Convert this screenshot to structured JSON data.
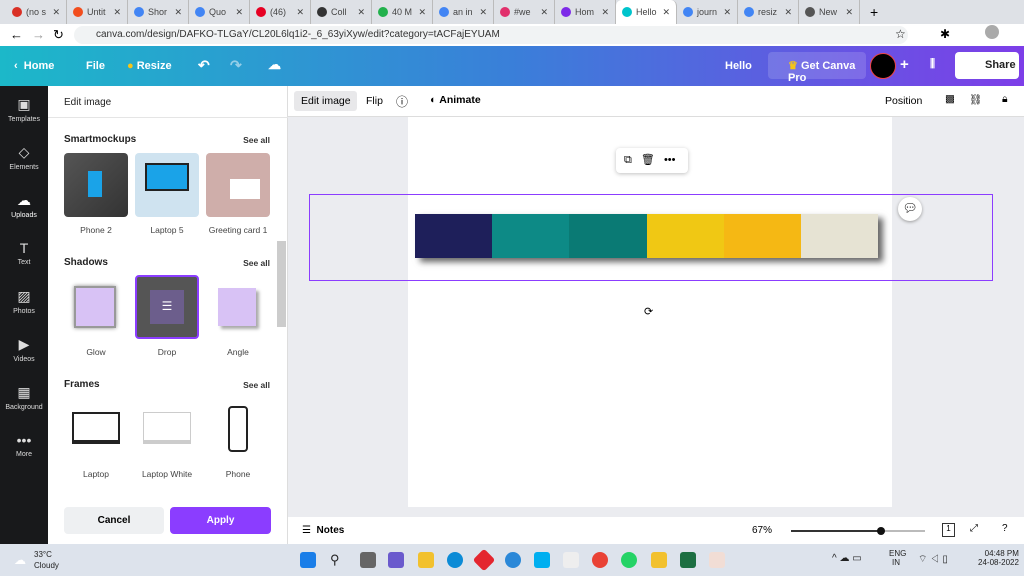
{
  "browser": {
    "tabs": [
      {
        "label": "(no s",
        "color": "#d93025"
      },
      {
        "label": "Untit",
        "color": "#f24e1e"
      },
      {
        "label": "Shor",
        "color": "#4285f4"
      },
      {
        "label": "Quo",
        "color": "#4285f4"
      },
      {
        "label": "(46)",
        "color": "#e60023"
      },
      {
        "label": "Coll",
        "color": "#333333"
      },
      {
        "label": "40 M",
        "color": "#22b14c"
      },
      {
        "label": "an in",
        "color": "#4285f4"
      },
      {
        "label": "#we",
        "color": "#e1306c"
      },
      {
        "label": "Hom",
        "color": "#7d2ae8"
      },
      {
        "label": "Hello",
        "color": "#00c4cc",
        "active": true
      },
      {
        "label": "journ",
        "color": "#4285f4"
      },
      {
        "label": "resiz",
        "color": "#4285f4"
      },
      {
        "label": "New",
        "color": "#555555"
      }
    ],
    "url": "canva.com/design/DAFKO-TLGaY/CL20L6lq1i2-_6_63yiXyw/edit?category=tACFajEYUAM"
  },
  "topbar": {
    "home": "Home",
    "file": "File",
    "resize": "Resize",
    "title": "Hello",
    "pro": "Get Canva Pro",
    "share": "Share"
  },
  "rail": [
    {
      "label": "Templates",
      "icon": "▣"
    },
    {
      "label": "Elements",
      "icon": "◇"
    },
    {
      "label": "Uploads",
      "icon": "☁"
    },
    {
      "label": "Text",
      "icon": "T"
    },
    {
      "label": "Photos",
      "icon": "▨"
    },
    {
      "label": "Videos",
      "icon": "▶"
    },
    {
      "label": "Background",
      "icon": "▦"
    },
    {
      "label": "More",
      "icon": "•••"
    }
  ],
  "panel": {
    "title": "Edit image",
    "see_all": "See all",
    "smartmockups": {
      "heading": "Smartmockups",
      "items": [
        "Phone 2",
        "Laptop 5",
        "Greeting card 1"
      ]
    },
    "shadows": {
      "heading": "Shadows",
      "items": [
        "Glow",
        "Drop",
        "Angle"
      ],
      "selected": "Drop"
    },
    "frames": {
      "heading": "Frames",
      "items": [
        "Laptop",
        "Laptop White",
        "Phone"
      ]
    },
    "cancel": "Cancel",
    "apply": "Apply"
  },
  "toolbar": {
    "edit_image": "Edit image",
    "flip": "Flip",
    "animate": "Animate",
    "position": "Position"
  },
  "palette": [
    "#1e1f5a",
    "#0d8a86",
    "#0a7a74",
    "#f0c814",
    "#f5b814",
    "#e6e3d3"
  ],
  "bottom": {
    "notes": "Notes",
    "zoom": "67%",
    "zoom_level": 0.67,
    "page": "1"
  },
  "taskbar": {
    "temp": "33°C",
    "weather": "Cloudy",
    "lang1": "ENG",
    "lang2": "IN",
    "time": "04:48 PM",
    "date": "24-08-2022"
  }
}
